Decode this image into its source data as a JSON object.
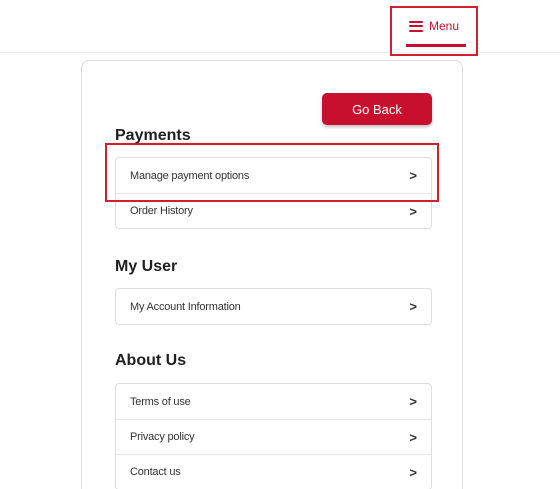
{
  "header": {
    "menu_label": "Menu",
    "menu_icon": "hamburger-icon",
    "accent_color": "#c8102e"
  },
  "card": {
    "go_back_label": "Go Back",
    "sections": [
      {
        "title": "Payments",
        "items": [
          {
            "label": "Manage payment options",
            "icon": "chevron-right-icon"
          },
          {
            "label": "Order History",
            "icon": "chevron-right-icon"
          }
        ]
      },
      {
        "title": "My User",
        "items": [
          {
            "label": "My Account Information",
            "icon": "chevron-right-icon"
          }
        ]
      },
      {
        "title": "About Us",
        "items": [
          {
            "label": "Terms of use",
            "icon": "chevron-right-icon"
          },
          {
            "label": "Privacy policy",
            "icon": "chevron-right-icon"
          },
          {
            "label": "Contact us",
            "icon": "chevron-right-icon"
          }
        ]
      }
    ]
  },
  "chevron_glyph": ">"
}
